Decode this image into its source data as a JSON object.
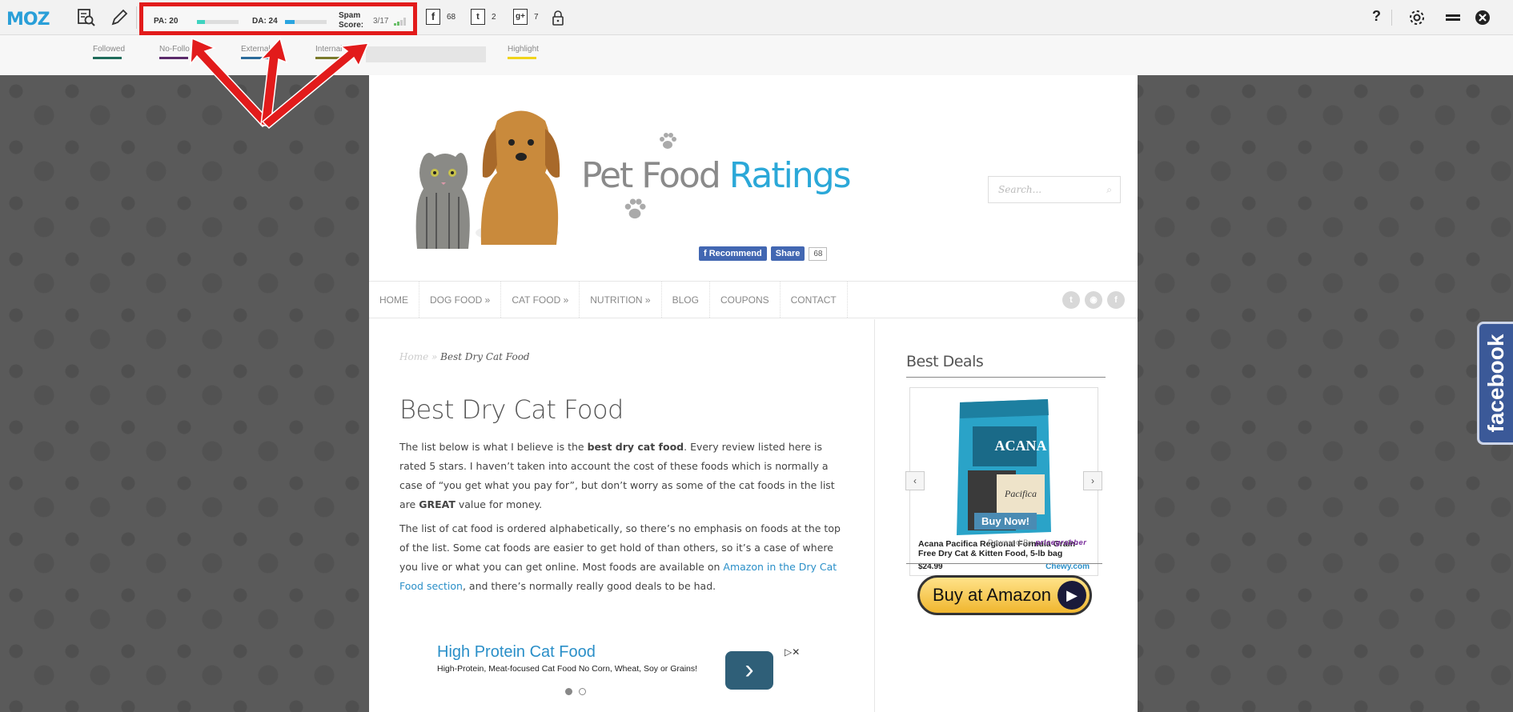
{
  "mozbar": {
    "logo": "MOZ",
    "pa_label": "PA: 20",
    "pa_value": 20,
    "da_label": "DA: 24",
    "da_value": 24,
    "spam_label_line1": "Spam",
    "spam_label_line2": "Score:",
    "spam_value": "3/17",
    "facebook_count": "68",
    "twitter_count": "2",
    "googleplus_count": "7",
    "help": "?"
  },
  "legend": {
    "items": [
      {
        "label": "Followed",
        "color": "#1e6b5a"
      },
      {
        "label": "No-Follo",
        "color": "#5a2a6a"
      },
      {
        "label": "External",
        "color": "#2a6a9a"
      },
      {
        "label": "Internal",
        "color": "#7a7a2a"
      },
      {
        "label": "Highlight",
        "color": "#f0d41a"
      }
    ]
  },
  "site": {
    "logo_part1": "Pet Food",
    "logo_part2": "Ratings",
    "search_placeholder": "Search...",
    "fb_recommend": "Recommend",
    "fb_share": "Share",
    "fb_count": "68",
    "nav": [
      "HOME",
      "DOG FOOD »",
      "CAT FOOD »",
      "NUTRITION »",
      "BLOG",
      "COUPONS",
      "CONTACT"
    ],
    "breadcrumb_home": "Home",
    "breadcrumb_sep": " » ",
    "breadcrumb_current": "Best Dry Cat Food",
    "title": "Best Dry Cat Food",
    "para1_a": "The list below is what I believe is the ",
    "para1_b": "best dry cat food",
    "para1_c": ". Every review listed here is rated 5 stars. I haven’t taken into account the cost of these foods which is normally a case of “you get what you pay for”, but don’t worry as some of the cat foods in the list are ",
    "para1_d": "GREAT",
    "para1_e": " value for money.",
    "para2_a": "The list of cat food is ordered alphabetically, so there’s no emphasis on foods at the top of the list. Some cat foods are easier to get hold of than others, so it’s a case of where you live or what you can get online. Most foods are available on ",
    "para2_link": "Amazon in the Dry Cat Food section",
    "para2_b": ", and there’s normally really good deals to be had.",
    "ad_title": "High Protein Cat Food",
    "ad_desc": "High-Protein, Meat-focused Cat Food No Corn, Wheat, Soy or Grains!",
    "sidebar_title": "Best Deals",
    "product_name": "Acana Pacifica Regional Formula Grain-Free Dry Cat & Kitten Food, 5-lb bag",
    "product_price": "$24.99",
    "product_store": "Chewy.com",
    "buy_now": "Buy Now!",
    "powered_by": "Powered By",
    "powered_brand": "pricegrabber",
    "amazon_button": "Buy at Amazon",
    "facebook_tab": "facebook"
  }
}
